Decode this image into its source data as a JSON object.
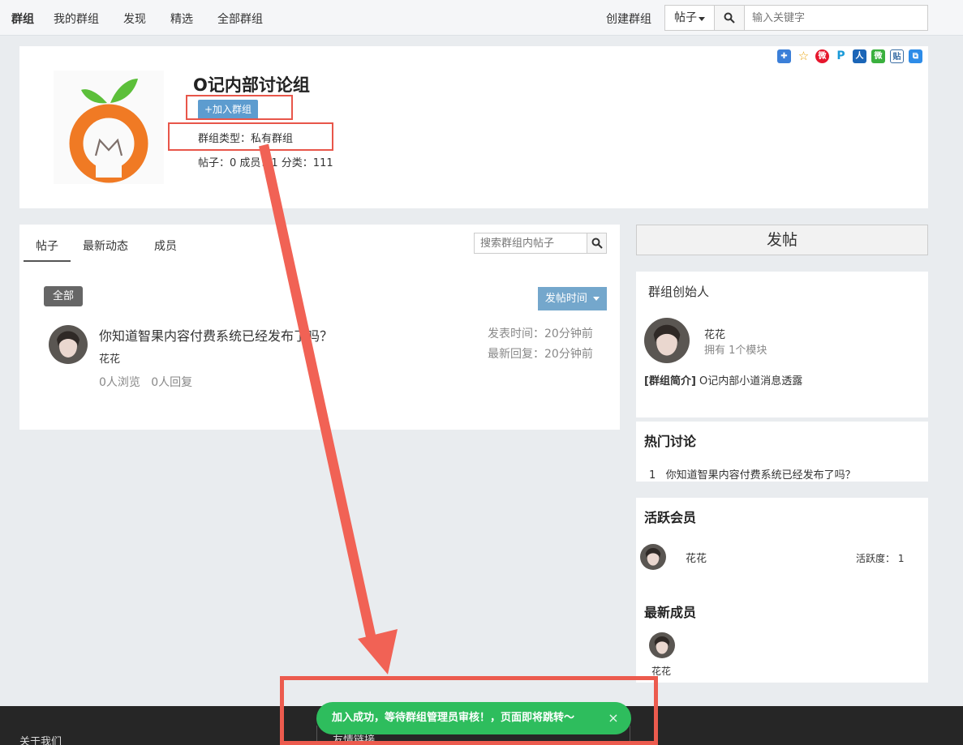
{
  "nav": {
    "brand": "群组",
    "items": [
      "我的群组",
      "发现",
      "精选",
      "全部群组"
    ],
    "create": "创建群组",
    "post_select": "帖子",
    "search_placeholder": "输入关键字"
  },
  "group": {
    "title": "O记内部讨论组",
    "join_label": "+加入群组",
    "type_text": "群组类型：私有群组",
    "stats_text": "帖子：0 成员：1 分类：111"
  },
  "tabs": [
    "帖子",
    "最新动态",
    "成员"
  ],
  "group_search_placeholder": "搜索群组内帖子",
  "filter": {
    "all_label": "全部",
    "sort_label": "发帖时间"
  },
  "post": {
    "title": "你知道智果内容付费系统已经发布了吗？",
    "author": "花花",
    "stats": "0人浏览   0人回复",
    "published": "发表时间：20分钟前",
    "last_reply": "最新回复：20分钟前"
  },
  "sidebar": {
    "new_post": "发帖",
    "founder_heading": "群组创始人",
    "founder_name": "花花",
    "founder_modules": "拥有 1个模块",
    "intro_label": "[群组简介]",
    "intro_text": " O记内部小道消息透露",
    "hot_heading": "热门讨论",
    "hot_item": "1   你知道智果内容付费系统已经发布了吗？",
    "active_heading": "活跃会员",
    "active_name": "花花",
    "active_score": "活跃度： 1",
    "newest_heading": "最新成员",
    "newest_name": "花花"
  },
  "footer": {
    "about": "关于我们",
    "links": "友情链接"
  },
  "toast": {
    "message": "加入成功，等待群组管理员审核！，页面即将跳转～",
    "close": "×"
  },
  "colors": {
    "accent_blue": "#5d9ccf",
    "toast_green": "#2ebd5d",
    "annotation_red": "#ec5b4e",
    "logo_orange": "#f07a24",
    "logo_green": "#5cbf3a"
  },
  "icons": [
    "search-icon",
    "caret-down-icon",
    "close-icon",
    "share-qzone-icon",
    "share-star-icon",
    "share-weibo-icon",
    "share-p-icon",
    "share-renren-icon",
    "share-wechat-icon",
    "share-tieba-icon",
    "share-copy-icon"
  ]
}
